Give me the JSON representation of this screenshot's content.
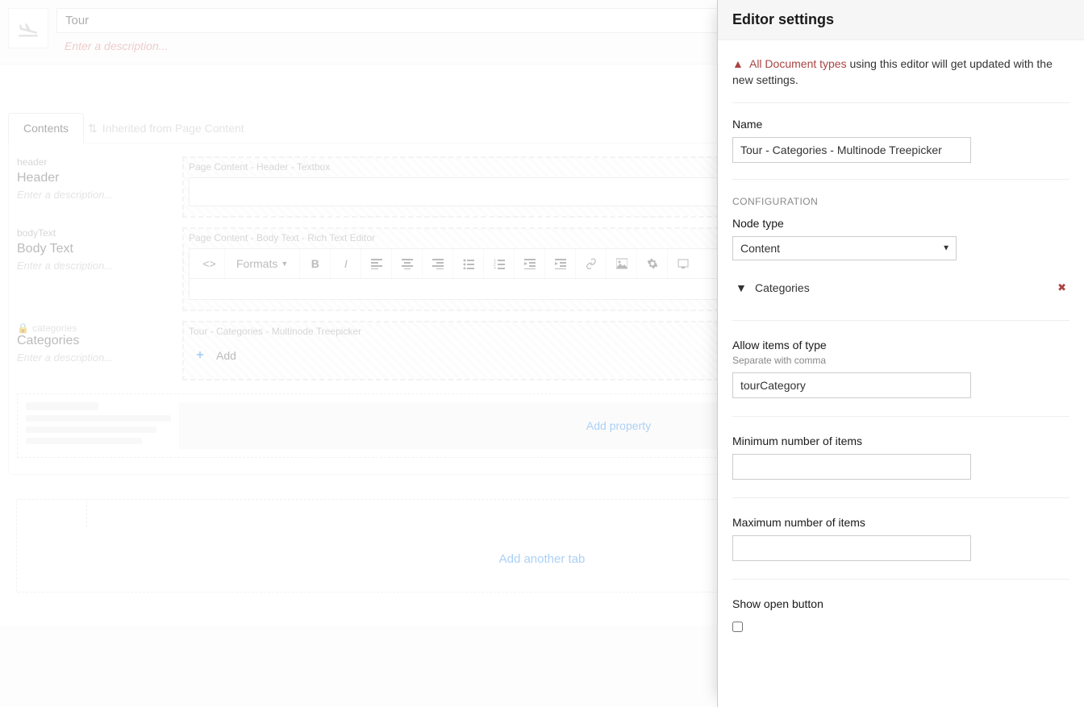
{
  "header": {
    "title_value": "Tour",
    "desc_placeholder": "Enter a description..."
  },
  "tabs": {
    "active": "Contents",
    "inherited": "Inherited from Page Content"
  },
  "properties": [
    {
      "alias": "header",
      "title": "Header",
      "desc_placeholder": "Enter a description...",
      "editor_label": "Page Content - Header - Textbox",
      "type": "textbox",
      "locked": false
    },
    {
      "alias": "bodyText",
      "title": "Body Text",
      "desc_placeholder": "Enter a description...",
      "editor_label": "Page Content - Body Text - Rich Text Editor",
      "type": "rte",
      "locked": false
    },
    {
      "alias": "categories",
      "title": "Categories",
      "desc_placeholder": "Enter a description...",
      "editor_label": "Tour - Categories - Multinode Treepicker",
      "type": "treepicker",
      "locked": true
    }
  ],
  "rte": {
    "formats_label": "Formats"
  },
  "treepicker_add": "Add",
  "add_property_label": "Add property",
  "add_tab_label": "Add another tab",
  "side_panel": {
    "title": "Editor settings",
    "warning_prefix": "All Document types",
    "warning_rest": " using this editor will get updated with the new settings.",
    "name_label": "Name",
    "name_value": "Tour - Categories - Multinode Treepicker",
    "config_heading": "CONFIGURATION",
    "node_type_label": "Node type",
    "node_type_value": "Content",
    "selected_node": "Categories",
    "allow_label": "Allow items of type",
    "allow_help": "Separate with comma",
    "allow_value": "tourCategory",
    "min_label": "Minimum number of items",
    "min_value": "",
    "max_label": "Maximum number of items",
    "max_value": "",
    "show_open_label": "Show open button",
    "show_open_checked": false
  }
}
